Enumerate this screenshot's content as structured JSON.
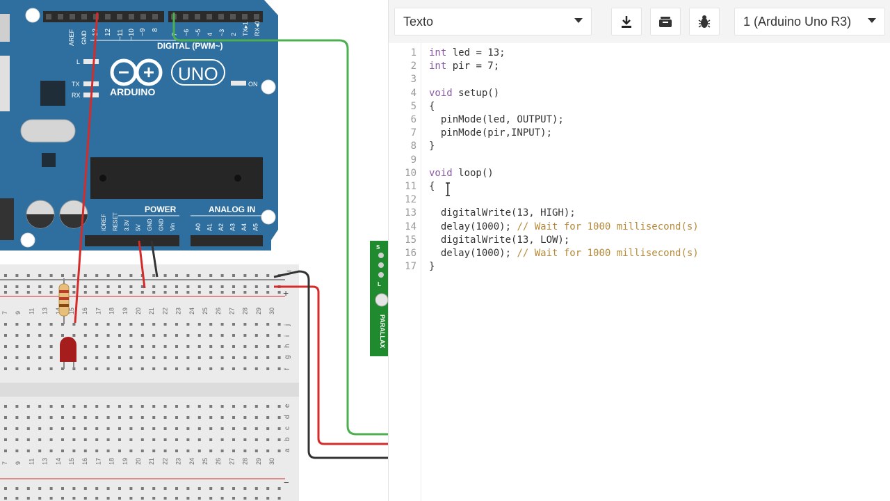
{
  "toolbar": {
    "mode_select": "Texto",
    "device_select": "1 (Arduino Uno R3)",
    "download_icon": "download-icon",
    "library_icon": "library-icon",
    "debug_icon": "bug-icon"
  },
  "editor": {
    "line_numbers": [
      "1",
      "2",
      "3",
      "4",
      "5",
      "6",
      "7",
      "8",
      "9",
      "10",
      "11",
      "12",
      "13",
      "14",
      "15",
      "16",
      "17"
    ],
    "lines": [
      {
        "kw": "int",
        "rest": " led = 13;",
        "cm": ""
      },
      {
        "kw": "int",
        "rest": " pir = 7;",
        "cm": ""
      },
      {
        "kw": "",
        "rest": "",
        "cm": ""
      },
      {
        "kw": "void",
        "rest": " setup()",
        "cm": ""
      },
      {
        "kw": "",
        "rest": "{",
        "cm": ""
      },
      {
        "kw": "",
        "rest": "  pinMode(led, OUTPUT);",
        "cm": ""
      },
      {
        "kw": "",
        "rest": "  pinMode(pir,INPUT);",
        "cm": ""
      },
      {
        "kw": "",
        "rest": "}",
        "cm": ""
      },
      {
        "kw": "",
        "rest": "",
        "cm": ""
      },
      {
        "kw": "void",
        "rest": " loop()",
        "cm": ""
      },
      {
        "kw": "",
        "rest": "{",
        "cm": ""
      },
      {
        "kw": "",
        "rest": "",
        "cm": ""
      },
      {
        "kw": "",
        "rest": "  digitalWrite(13, HIGH);",
        "cm": ""
      },
      {
        "kw": "",
        "rest": "  delay(1000); ",
        "cm": "// Wait for 1000 millisecond(s)"
      },
      {
        "kw": "",
        "rest": "  digitalWrite(13, LOW);",
        "cm": ""
      },
      {
        "kw": "",
        "rest": "  delay(1000); ",
        "cm": "// Wait for 1000 millisecond(s)"
      },
      {
        "kw": "",
        "rest": "}",
        "cm": ""
      }
    ]
  },
  "board": {
    "brand": "ARDUINO",
    "model": "UNO",
    "digital_label": "DIGITAL (PWM~)",
    "power_label": "POWER",
    "analog_label": "ANALOG IN",
    "on_label": "ON",
    "l_label": "L",
    "tx_label": "TX",
    "rx_label": "RX",
    "aref_label": "AREF",
    "gnd_label": "GND",
    "top_pins": [
      "13",
      "12",
      "~11",
      "~10",
      "~9",
      "8"
    ],
    "top_pins2": [
      "7",
      "~6",
      "~5",
      "4",
      "~3",
      "2",
      "TX▸1",
      "RX◂0"
    ],
    "power_pins": [
      "IOREF",
      "RESET",
      "3.3V",
      "5V",
      "GND",
      "GND",
      "Vin"
    ],
    "analog_pins": [
      "A0",
      "A1",
      "A2",
      "A3",
      "A4",
      "A5"
    ],
    "board_color": "#2f6f9f"
  },
  "sensor": {
    "brand": "PARALLAX",
    "pin_labels": [
      "S",
      "+",
      "-",
      "L"
    ]
  },
  "breadboard": {
    "column_numbers": [
      "7",
      "9",
      "11",
      "13",
      "14",
      "15",
      "16",
      "17",
      "18",
      "19",
      "20",
      "21",
      "22",
      "23",
      "24",
      "25",
      "26",
      "27",
      "28",
      "29",
      "30"
    ],
    "row_letters_top": [
      "j",
      "i",
      "h",
      "g",
      "f"
    ],
    "row_letters_bottom": [
      "e",
      "d",
      "c",
      "b",
      "a"
    ],
    "plus": "+",
    "minus": "−"
  },
  "colors": {
    "wire_red": "#d42b2b",
    "wire_green": "#4caf50",
    "wire_black": "#333333",
    "keyword": "#8a5aa6",
    "comment": "#b58a3a"
  }
}
